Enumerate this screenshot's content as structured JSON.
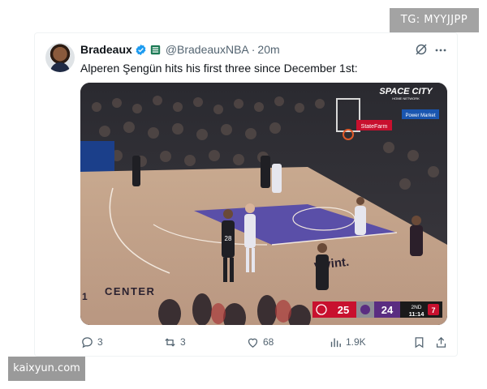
{
  "overlay": {
    "tg_label": "TG: MYYJJPP",
    "watermark": "kaixyun.com"
  },
  "tweet": {
    "author_name": "Bradeaux",
    "handle": "@BradeauxNBA",
    "separator": "·",
    "time": "20m",
    "text": "Alperen Şengün hits his first three since December 1st:",
    "verified_color": "#1d9bf0"
  },
  "media": {
    "brand": "SPACE CITY",
    "brand_sub": "HOME NETWORK",
    "sponsor_board": "Power Market",
    "statefarm": "StateFarm",
    "center_text": "CENTER",
    "center_prefix": "1",
    "court_logo": "vivint.",
    "jersey_number": "28",
    "scoreboard": {
      "home_score": "25",
      "away_score": "24",
      "quarter": "2ND",
      "clock": "11:14",
      "shot_clock": "7"
    }
  },
  "actions": {
    "replies": "3",
    "reposts": "3",
    "likes": "68",
    "views": "1.9K"
  },
  "colors": {
    "rockets_red": "#c8102e",
    "kings_purple": "#5a2d81",
    "text_secondary": "#536471"
  }
}
